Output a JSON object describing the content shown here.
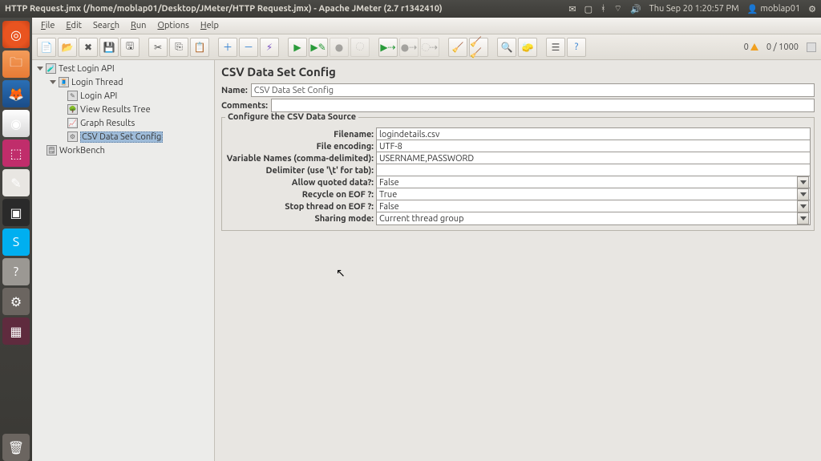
{
  "topbar": {
    "title": "HTTP Request.jmx (/home/moblap01/Desktop/JMeter/HTTP Request.jmx) - Apache JMeter (2.7 r1342410)",
    "datetime": "Thu Sep 20  1:20:57 PM",
    "user": "moblap01"
  },
  "menu": {
    "file": "File",
    "edit": "Edit",
    "search": "Search",
    "run": "Run",
    "options": "Options",
    "help": "Help"
  },
  "counter": {
    "warn": "0",
    "info": "0 / 1000"
  },
  "tree": {
    "root": "Test Login API",
    "thread": "Login Thread",
    "items": [
      "Login API",
      "View Results Tree",
      "Graph Results",
      "CSV Data Set Config"
    ],
    "workbench": "WorkBench"
  },
  "panel": {
    "title": "CSV Data Set Config",
    "name_label": "Name:",
    "name_value": "CSV Data Set Config",
    "comments_label": "Comments:",
    "fieldset_title": "Configure the CSV Data Source",
    "rows": {
      "filename": {
        "label": "Filename:",
        "value": "logindetails.csv"
      },
      "encoding": {
        "label": "File encoding:",
        "value": "UTF-8"
      },
      "varnames": {
        "label": "Variable Names (comma-delimited):",
        "value": "USERNAME,PASSWORD"
      },
      "delimiter": {
        "label": "Delimiter (use '\\t' for tab):",
        "value": ""
      },
      "quoted": {
        "label": "Allow quoted data?:",
        "value": "False"
      },
      "recycle": {
        "label": "Recycle on EOF ?:",
        "value": "True"
      },
      "stop": {
        "label": "Stop thread on EOF ?:",
        "value": "False"
      },
      "sharing": {
        "label": "Sharing mode:",
        "value": "Current thread group"
      }
    }
  }
}
